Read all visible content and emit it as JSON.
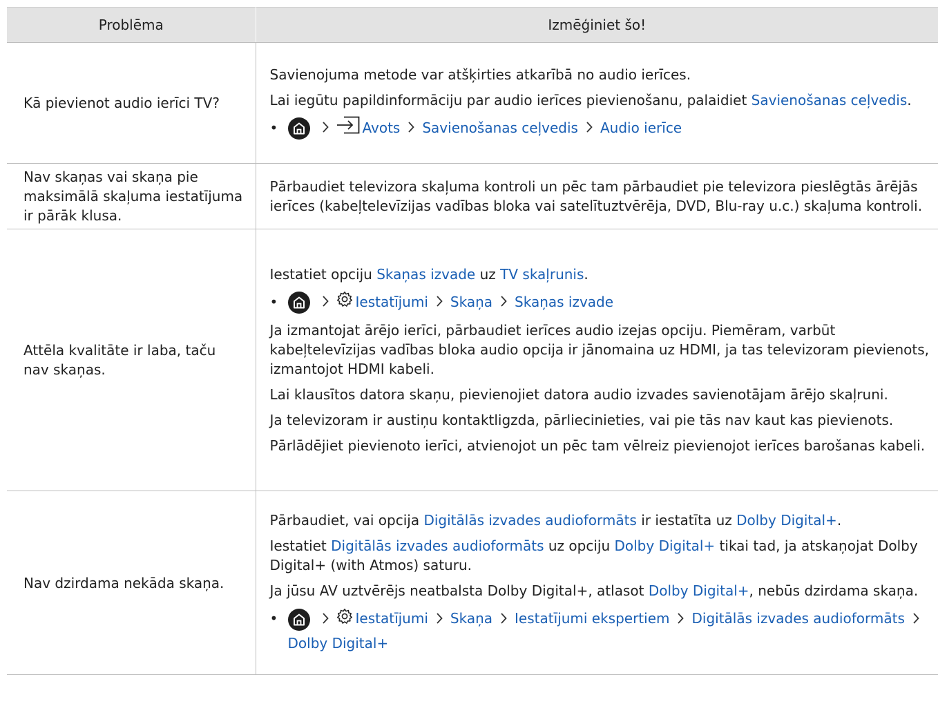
{
  "header": {
    "col1": "Problēma",
    "col2": "Izmēģiniet šo!"
  },
  "rows": [
    {
      "problem": "Kā pievienot audio ierīci TV?",
      "p1": "Savienojuma metode var atšķirties atkarībā no audio ierīces.",
      "p2_pre": "Lai iegūtu papildinformāciju par audio ierīces pievienošanu, palaidiet ",
      "p2_link": "Savienošanas ceļvedis",
      "p2_post": ".",
      "path": [
        "Avots",
        "Savienošanas ceļvedis",
        "Audio ierīce"
      ]
    },
    {
      "problem": "Nav skaņas vai skaņa pie maksimālā skaļuma iestatījuma ir pārāk klusa.",
      "p1": "Pārbaudiet televizora skaļuma kontroli un pēc tam pārbaudiet pie televizora pieslēgtās ārējās ierīces (kabeļtelevīzijas vadības bloka vai satelītuztvērēja, DVD, Blu-ray u.c.) skaļuma kontroli."
    },
    {
      "problem": "Attēla kvalitāte ir laba, taču nav skaņas.",
      "p1_pre": "Iestatiet opciju ",
      "p1_link1": "Skaņas izvade",
      "p1_mid": " uz ",
      "p1_link2": "TV skaļrunis",
      "p1_post": ".",
      "path": [
        "Iestatījumi",
        "Skaņa",
        "Skaņas izvade"
      ],
      "p2": "Ja izmantojat ārējo ierīci, pārbaudiet ierīces audio izejas opciju. Piemēram, varbūt kabeļtelevīzijas vadības bloka audio opcija ir jānomaina uz HDMI, ja tas televizoram pievienots, izmantojot HDMI kabeli.",
      "p3": "Lai klausītos datora skaņu, pievienojiet datora audio izvades savienotājam ārējo skaļruni.",
      "p4": "Ja televizoram ir austiņu kontaktligzda, pārliecinieties, vai pie tās nav kaut kas pievienots.",
      "p5": "Pārlādējiet pievienoto ierīci, atvienojot un pēc tam vēlreiz pievienojot ierīces barošanas kabeli."
    },
    {
      "problem": "Nav dzirdama nekāda skaņa.",
      "p1_pre": "Pārbaudiet, vai opcija ",
      "p1_link1": "Digitālās izvades audioformāts",
      "p1_mid": " ir iestatīta uz ",
      "p1_link2": "Dolby Digital+",
      "p1_post": ".",
      "p2_pre": "Iestatiet ",
      "p2_link1": "Digitālās izvades audioformāts",
      "p2_mid": " uz opciju ",
      "p2_link2": "Dolby Digital+",
      "p2_post": " tikai tad, ja atskaņojat Dolby Digital+ (with Atmos) saturu.",
      "p3_pre": "Ja jūsu AV uztvērējs neatbalsta Dolby Digital+, atlasot ",
      "p3_link": "Dolby Digital+",
      "p3_post": ", nebūs dzirdama skaņa.",
      "path": [
        "Iestatījumi",
        "Skaņa",
        "Iestatījumi ekspertiem",
        "Digitālās izvades audioformāts",
        "Dolby Digital+"
      ]
    }
  ],
  "icons": {
    "bullet": "•",
    "chevron": "chevron-right-icon",
    "home": "home-icon",
    "source": "source-input-icon",
    "settings": "gear-icon"
  },
  "colors": {
    "link": "#1a5fb4",
    "header_bg": "#e3e3e3",
    "text": "#222222"
  }
}
